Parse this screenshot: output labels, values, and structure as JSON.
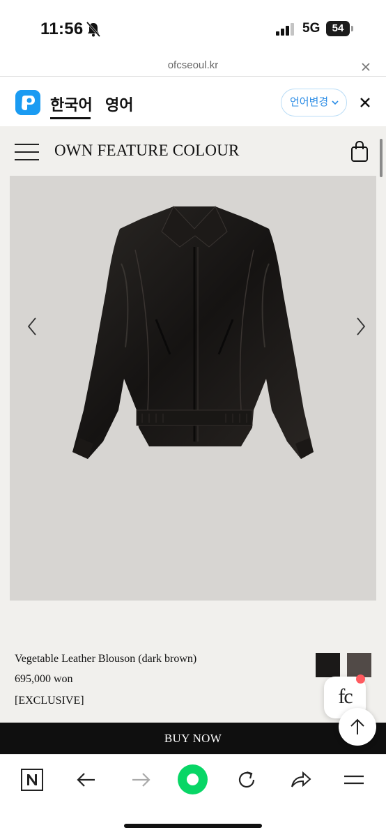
{
  "status_bar": {
    "time": "11:56",
    "network": "5G",
    "battery": "54"
  },
  "browser": {
    "url": "ofcseoul.kr"
  },
  "translate_bar": {
    "lang_source": "한국어",
    "lang_target": "영어",
    "change_label": "언어변경",
    "accent_color": "#2c8de6"
  },
  "site": {
    "brand": "OWN FEATURE COLOUR"
  },
  "product": {
    "name": "Vegetable Leather Blouson (dark brown)",
    "price": "695,000 won",
    "tag": "[EXCLUSIVE]",
    "swatch_colors": [
      "#1b1918",
      "#514a47"
    ],
    "buy_label": "BUY NOW",
    "badge_text": "fc"
  },
  "icons": {
    "bell": "bell-slash-icon",
    "signal": "signal-icon",
    "close": "close-icon",
    "papago": "papago-logo-icon",
    "chevron": "chevron-down-icon",
    "menu": "hamburger-menu-icon",
    "bag": "shopping-bag-icon",
    "prev": "chevron-left-icon",
    "next": "chevron-right-icon",
    "top": "arrow-up-icon",
    "toolbar": [
      "naver-n-icon",
      "back-arrow-icon",
      "forward-arrow-icon",
      "home-green-icon",
      "reload-icon",
      "share-icon",
      "menu-lines-icon"
    ]
  }
}
